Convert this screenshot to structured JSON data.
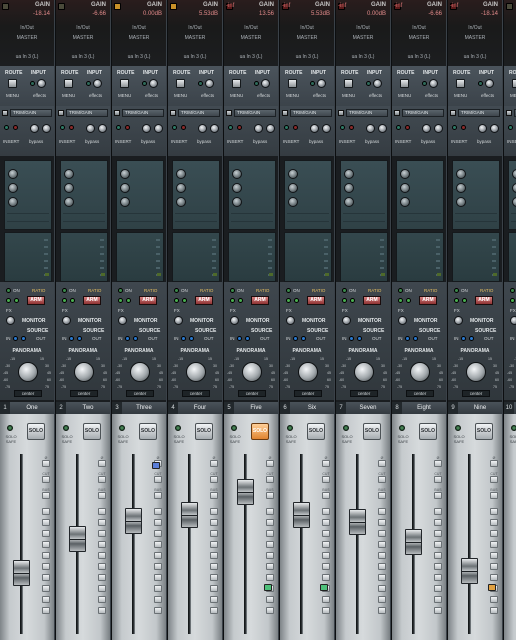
{
  "channels": [
    {
      "number": "1",
      "name": "One",
      "gain_label": "GAIN",
      "gain": "-18.14",
      "peak": "off",
      "io": "In/Out",
      "output": "MASTER",
      "input": "ua In 3 (L)",
      "solo_on": false,
      "fader_level": 0.34,
      "color_led": null
    },
    {
      "number": "2",
      "name": "Two",
      "gain_label": "GAIN",
      "gain": "-6.66",
      "peak": "off",
      "io": "In/Out",
      "output": "MASTER",
      "input": "ua In 3 (L)",
      "solo_on": false,
      "fader_level": 0.53,
      "color_led": null
    },
    {
      "number": "3",
      "name": "Three",
      "gain_label": "GAIN",
      "gain": "0.00dB",
      "peak": "on",
      "io": "In/Out",
      "output": "MASTER",
      "input": "ua In 3 (L)",
      "solo_on": false,
      "fader_level": 0.63,
      "color_led": "#5a7ed8"
    },
    {
      "number": "4",
      "name": "Four",
      "gain_label": "GAIN",
      "gain": "5.53dB",
      "peak": "on",
      "io": "In/Out",
      "output": "MASTER",
      "input": "ua In 3 (L)",
      "solo_on": false,
      "fader_level": 0.66,
      "color_led": null
    },
    {
      "number": "5",
      "name": "Five",
      "gain_label": "GAIN",
      "gain": "13.56",
      "gain_left": "-inf",
      "peak": "clip",
      "io": "In/Out",
      "output": "MASTER",
      "input": "ua In 3 (L)",
      "solo_on": true,
      "fader_level": 0.79,
      "color_led": "#4ec07a"
    },
    {
      "number": "6",
      "name": "Six",
      "gain_label": "GAIN",
      "gain": "5.53dB",
      "gain_left": "-inf",
      "peak": "clip",
      "io": "In/Out",
      "output": "MASTER",
      "input": "ua In 3 (L)",
      "solo_on": false,
      "fader_level": 0.66,
      "color_led": "#4ec07a"
    },
    {
      "number": "7",
      "name": "Seven",
      "gain_label": "GAIN",
      "gain": "0.00dB",
      "gain_left": "-inf",
      "peak": "clip",
      "io": "In/Out",
      "output": "MASTER",
      "input": "ua In 3 (L)",
      "solo_on": false,
      "fader_level": 0.62,
      "color_led": null
    },
    {
      "number": "8",
      "name": "Eight",
      "gain_label": "GAIN",
      "gain": "-6.66",
      "gain_left": "-inf",
      "peak": "clip",
      "io": "In/Out",
      "output": "MASTER",
      "input": "ua In 3 (L)",
      "solo_on": false,
      "fader_level": 0.51,
      "color_led": null
    },
    {
      "number": "9",
      "name": "Nine",
      "gain_label": "GAIN",
      "gain": "-18.14",
      "gain_left": "-inf",
      "peak": "clip",
      "io": "In/Out",
      "output": "MASTER",
      "input": "ua In 3 (L)",
      "solo_on": false,
      "fader_level": 0.35,
      "color_led": "#e0a040"
    },
    {
      "number": "10",
      "name": "",
      "gain_label": "",
      "gain": "",
      "peak": "off",
      "io": "",
      "output": "",
      "input": "",
      "solo_on": false,
      "fader_level": 0.3,
      "color_led": null
    }
  ],
  "labels": {
    "route": "ROUTE",
    "input": "INPUT",
    "menu": "MENU",
    "effects": "effects",
    "trim": "TRIM/GAIN",
    "insert": "INSERT",
    "bypass": "bypass",
    "on": "ON",
    "ratio": "RATIO",
    "arm": "ARM",
    "fx": "FX",
    "monitor": "MONITOR",
    "source": "SOURCE",
    "in": "IN",
    "out": "OUT",
    "panorama": "PANORAMA",
    "center": "center",
    "solo": "SOLO",
    "solo_safe": "SOLO SAFE",
    "cut": "CUT",
    "bus": "BUS",
    "phi": "Ø",
    "pan_marks": [
      "-15",
      "15",
      "-30",
      "30",
      "-45",
      "45",
      "-60",
      "60",
      "-75",
      "75",
      "-100",
      "100"
    ]
  },
  "colors": {
    "arm": "#c44848",
    "solo_active": "#e08430",
    "accent_green": "#4ec07a"
  }
}
